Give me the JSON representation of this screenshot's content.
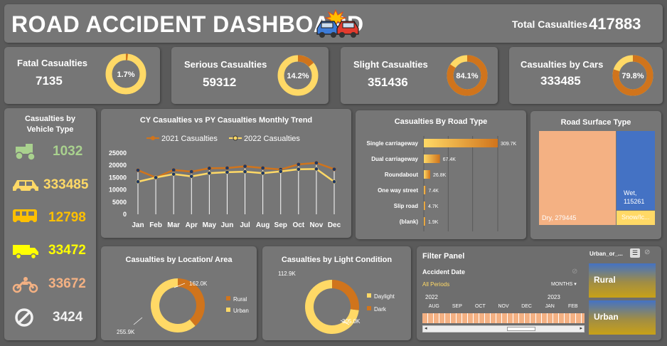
{
  "header": {
    "title": "ROAD ACCIDENT DASHBOARD",
    "total_label": "Total Casualties",
    "total_value": "417883"
  },
  "kpis": [
    {
      "label": "Fatal Casualties",
      "value": "7135",
      "pct": "1.7%",
      "fraction": 0.017
    },
    {
      "label": "Serious Casualties",
      "value": "59312",
      "pct": "14.2%",
      "fraction": 0.142
    },
    {
      "label": "Slight Casualties",
      "value": "351436",
      "pct": "84.1%",
      "fraction": 0.841
    },
    {
      "label": "Casualties by Cars",
      "value": "333485",
      "pct": "79.8%",
      "fraction": 0.798
    }
  ],
  "vehicle": {
    "title_line1": "Casualties by",
    "title_line2": "Vehicle Type",
    "items": [
      {
        "icon": "tractor-icon",
        "value": "1032",
        "color": "#a9d18e"
      },
      {
        "icon": "car-icon",
        "value": "333485",
        "color": "#ffd966"
      },
      {
        "icon": "bus-icon",
        "value": "12798",
        "color": "#ffc000"
      },
      {
        "icon": "truck-icon",
        "value": "33472",
        "color": "#ffff00"
      },
      {
        "icon": "motorcycle-icon",
        "value": "33672",
        "color": "#f4b183"
      },
      {
        "icon": "no-entry-icon",
        "value": "3424",
        "color": "#f2f2f2"
      }
    ]
  },
  "trend": {
    "title": "CY Casualties vs PY Casualties Monthly Trend",
    "legend_2021": "2021 Casualties",
    "legend_2022": "2022 Casualties"
  },
  "road_type": {
    "title": "Casualties By Road Type"
  },
  "surface": {
    "title": "Road Surface Type",
    "dry_label": "Dry, 279445",
    "wet_label_1": "Wet,",
    "wet_label_2": "115261",
    "snow_label": "Snow/Ic..."
  },
  "location": {
    "title": "Casualties by Location/ Area",
    "legend": [
      "Rural",
      "Urban"
    ],
    "rural_label": "162.0K",
    "urban_label": "255.9K"
  },
  "light": {
    "title": "Casualties by Light Condition",
    "legend": [
      "Daylight",
      "Dark"
    ],
    "dark_label": "112.9K",
    "daylight_label": "305.0K"
  },
  "filter": {
    "title": "Filter Panel",
    "slicer_title": "Urban_or_...",
    "date_label": "Accident Date",
    "period_label": "All Periods",
    "granularity": "MONTHS",
    "year1": "2022",
    "year2": "2023",
    "months": [
      "AUG",
      "SEP",
      "OCT",
      "NOV",
      "DEC",
      "JAN",
      "FEB"
    ],
    "buttons": [
      "Rural",
      "Urban"
    ]
  },
  "colors": {
    "orange": "#d0741c",
    "yellow": "#ffd966",
    "bg": "#767676",
    "page": "#5a5a5a"
  },
  "chart_data": [
    {
      "type": "line",
      "title": "CY Casualties vs PY Casualties Monthly Trend",
      "categories": [
        "Jan",
        "Feb",
        "Mar",
        "Apr",
        "May",
        "Jun",
        "Jul",
        "Aug",
        "Sep",
        "Oct",
        "Nov",
        "Dec"
      ],
      "series": [
        {
          "name": "2021 Casualties",
          "values": [
            18000,
            15000,
            18100,
            17400,
            18800,
            18900,
            19600,
            18900,
            18300,
            20400,
            21000,
            18400
          ]
        },
        {
          "name": "2022 Casualties",
          "values": [
            13300,
            15000,
            16400,
            15500,
            16800,
            17200,
            17400,
            16800,
            17500,
            18400,
            18500,
            13300
          ]
        }
      ],
      "yticks": [
        0,
        5000,
        10000,
        15000,
        20000,
        25000
      ],
      "ylim": [
        0,
        25000
      ]
    },
    {
      "type": "bar",
      "title": "Casualties By Road Type",
      "categories": [
        "Single carriageway",
        "Dual carriageway",
        "Roundabout",
        "One way street",
        "Slip road",
        "(blank)"
      ],
      "values": [
        309700,
        67400,
        26800,
        7400,
        4700,
        1900
      ],
      "labels": [
        "309.7K",
        "67.4K",
        "26.8K",
        "7.4K",
        "4.7K",
        "1.9K"
      ]
    },
    {
      "type": "treemap",
      "title": "Road Surface Type",
      "categories": [
        "Dry",
        "Wet",
        "Snow/Ice"
      ],
      "values": [
        279445,
        115261,
        null
      ]
    },
    {
      "type": "pie",
      "title": "Casualties by Location/ Area",
      "categories": [
        "Rural",
        "Urban"
      ],
      "values": [
        162000,
        255900
      ]
    },
    {
      "type": "pie",
      "title": "Casualties by Light Condition",
      "categories": [
        "Daylight",
        "Dark"
      ],
      "values": [
        305000,
        112900
      ]
    }
  ]
}
